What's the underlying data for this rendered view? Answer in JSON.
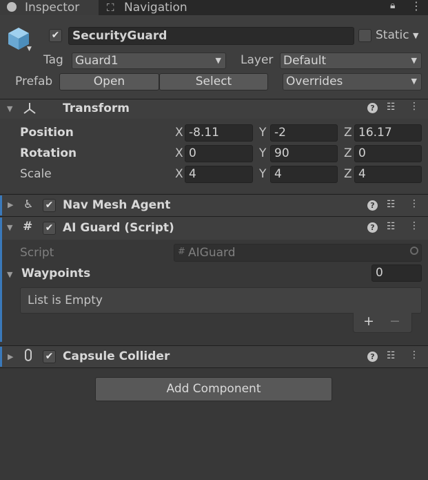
{
  "tabs": {
    "inspector": "Inspector",
    "navigation": "Navigation",
    "lock_icon": "lock-icon",
    "more_icon": "kebab-icon"
  },
  "object": {
    "enabled": true,
    "name": "SecurityGuard",
    "static_label": "Static",
    "static_checked": false,
    "tag_label": "Tag",
    "tag_value": "Guard1",
    "layer_label": "Layer",
    "layer_value": "Default",
    "prefab_label": "Prefab",
    "open_label": "Open",
    "select_label": "Select",
    "overrides_label": "Overrides"
  },
  "transform": {
    "title": "Transform",
    "position_label": "Position",
    "rotation_label": "Rotation",
    "scale_label": "Scale",
    "axis_x": "X",
    "axis_y": "Y",
    "axis_z": "Z",
    "position": {
      "x": "-8.11",
      "y": "-2",
      "z": "16.17"
    },
    "rotation": {
      "x": "0",
      "y": "90",
      "z": "0"
    },
    "scale": {
      "x": "4",
      "y": "4",
      "z": "4"
    }
  },
  "nav_mesh_agent": {
    "title": "Nav Mesh Agent",
    "enabled": true
  },
  "ai_guard": {
    "title": "AI Guard (Script)",
    "enabled": true,
    "script_label": "Script",
    "script_value": "AIGuard",
    "waypoints_label": "Waypoints",
    "waypoints_count": "0",
    "list_empty": "List is Empty",
    "add": "+",
    "remove": "−"
  },
  "capsule_collider": {
    "title": "Capsule Collider",
    "enabled": true
  },
  "add_component": "Add Component",
  "colors": {
    "accent": "#3a79bb",
    "background": "#383838",
    "header": "#3f3f3f"
  }
}
